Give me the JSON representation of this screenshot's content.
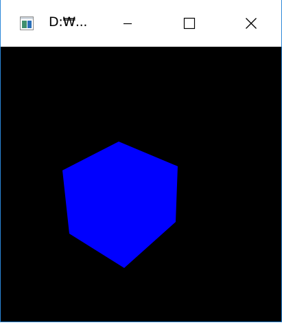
{
  "window": {
    "title": "D:₩...",
    "accent_color": "#2b87d8"
  },
  "titlebar": {
    "icon": "application-window-icon",
    "buttons": [
      {
        "name": "minimize",
        "icon": "minimize-icon"
      },
      {
        "name": "maximize",
        "icon": "maximize-icon"
      },
      {
        "name": "close",
        "icon": "close-icon"
      }
    ]
  },
  "scene": {
    "background_color": "#000000",
    "object": "cube",
    "cube_color": "#0000ff"
  }
}
